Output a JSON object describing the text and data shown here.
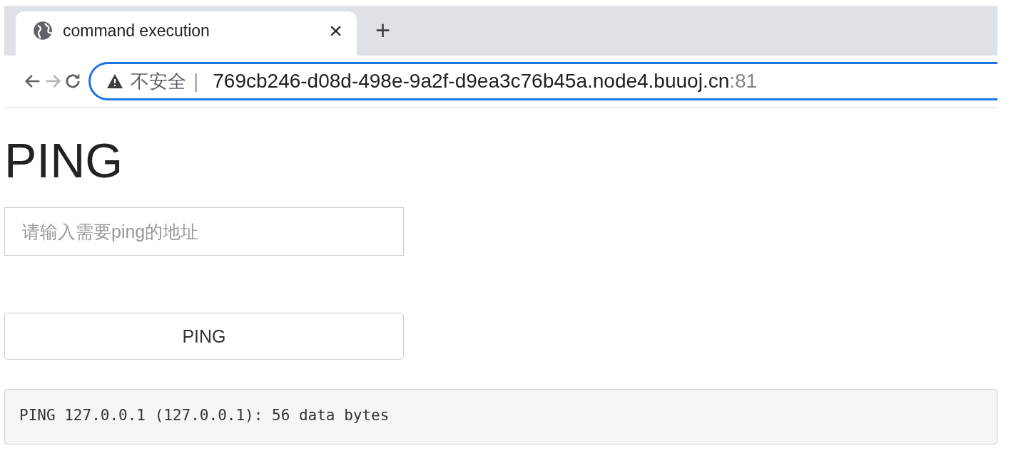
{
  "tab": {
    "title": "command execution",
    "close": "×",
    "new_tab": "+"
  },
  "address_bar": {
    "security": "不安全",
    "separator": "|",
    "host": "769cb246-d08d-498e-9a2f-d9ea3c76b45a.node4.buuoj.cn",
    "port": ":81"
  },
  "nav": {
    "back_disabled": false,
    "forward_disabled": true
  },
  "page": {
    "heading": "PING",
    "input": {
      "placeholder": "请输入需要ping的地址"
    },
    "button": "PING",
    "output": "PING 127.0.0.1 (127.0.0.1): 56 data bytes"
  }
}
